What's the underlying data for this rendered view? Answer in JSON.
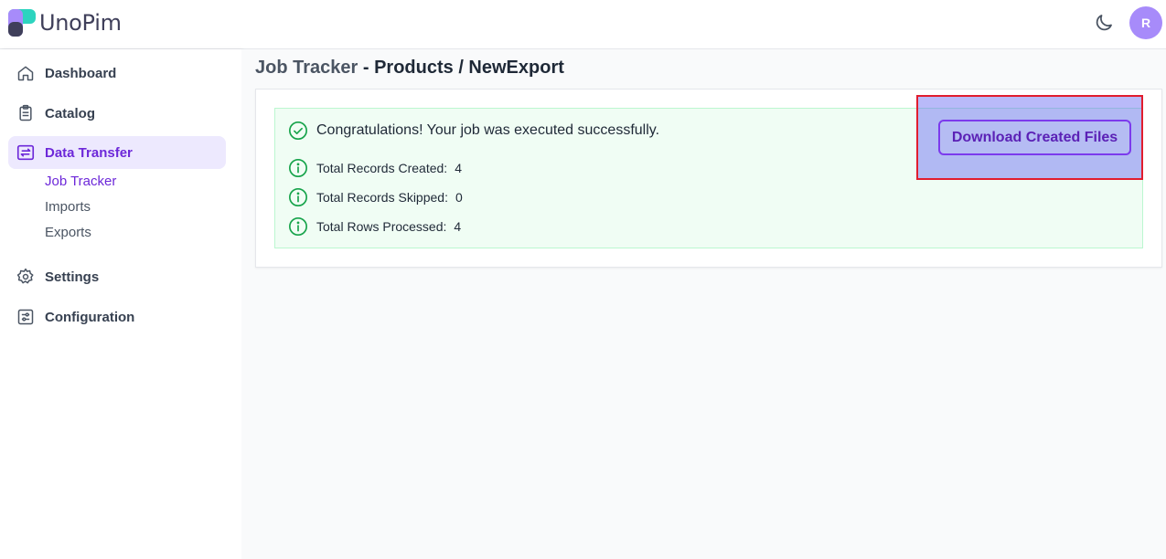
{
  "app": {
    "brand": "UnoPim",
    "avatar_initial": "R"
  },
  "colors": {
    "accent": "#7c3aed",
    "active_bg": "#ede9fe",
    "success_bg": "#f0fdf4",
    "success_icon": "#16a34a"
  },
  "sidebar": {
    "items": [
      {
        "label": "Dashboard",
        "icon": "home-icon"
      },
      {
        "label": "Catalog",
        "icon": "clipboard-icon"
      },
      {
        "label": "Data Transfer",
        "icon": "transfer-icon",
        "active": true,
        "children": [
          {
            "label": "Job Tracker",
            "active": true
          },
          {
            "label": "Imports"
          },
          {
            "label": "Exports"
          }
        ]
      },
      {
        "label": "Settings",
        "icon": "gear-icon"
      },
      {
        "label": "Configuration",
        "icon": "sliders-icon"
      }
    ]
  },
  "page": {
    "title_prefix": "Job Tracker",
    "title_rest": "- Products / NewExport"
  },
  "job": {
    "success_message": "Congratulations! Your job was executed successfully.",
    "stats": [
      {
        "label": "Total Records Created:",
        "value": "4"
      },
      {
        "label": "Total Records Skipped:",
        "value": "0"
      },
      {
        "label": "Total Rows Processed:",
        "value": "4"
      }
    ],
    "download_label": "Download Created Files"
  }
}
